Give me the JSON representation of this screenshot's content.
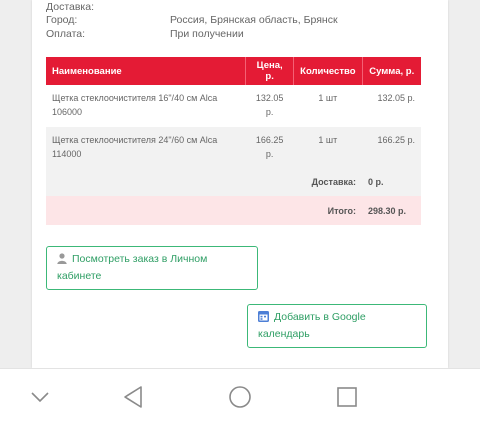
{
  "order_info": {
    "delivery_label": "Доставка:",
    "city_label": "Город:",
    "city_value": "Россия, Брянская область, Брянск",
    "payment_label": "Оплата:",
    "payment_value": "При получении"
  },
  "table": {
    "headers": [
      "Наименование",
      "Цена, р.",
      "Количество",
      "Сумма, р."
    ],
    "rows": [
      {
        "name": "Щетка стеклоочистителя 16\"/40 см Alca 106000",
        "price": "132.05 р.",
        "qty": "1 шт",
        "sum": "132.05 р."
      },
      {
        "name": "Щетка стеклоочистителя 24\"/60 см Alca 114000",
        "price": "166.25 р.",
        "qty": "1 шт",
        "sum": "166.25 р."
      }
    ],
    "delivery_label": "Доставка:",
    "delivery_value": "0 р.",
    "total_label": "Итого:",
    "total_value": "298.30 р."
  },
  "buttons": {
    "view_order": "Посмотреть заказ в Личном кабинете",
    "add_calendar": "Добавить в Google календарь"
  },
  "icons": {
    "view_order": "user-icon",
    "add_calendar": "calendar-icon",
    "nav_down": "chevron-down-icon",
    "nav_back": "back-triangle-icon",
    "nav_home": "home-circle-icon",
    "nav_recents": "recents-square-icon"
  },
  "colors": {
    "accent_red": "#e41b35",
    "total_row_bg": "#fde5e7",
    "button_green": "#3cb878"
  }
}
